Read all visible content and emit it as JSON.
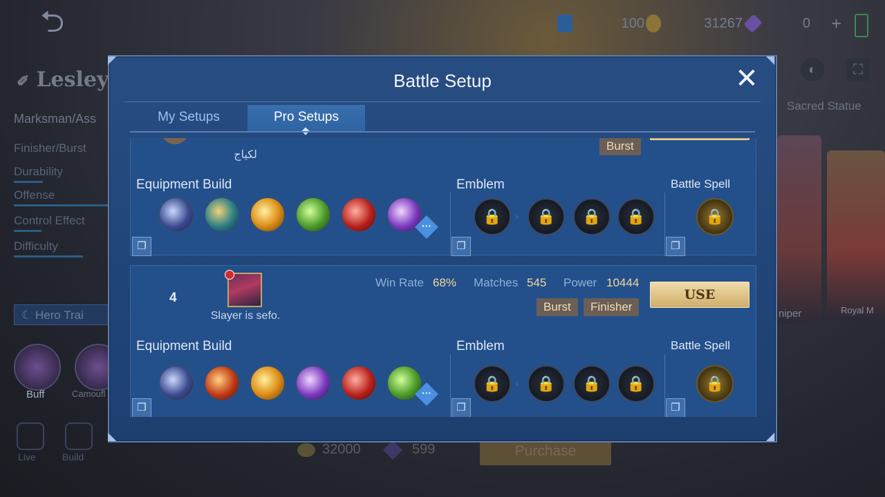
{
  "background": {
    "hero_name": "Lesley",
    "hero_role": "Marksman/Ass",
    "hero_specialty": "Finisher/Burst",
    "hero_stats": [
      "Durability",
      "Offense",
      "Control Effect",
      "Difficulty"
    ],
    "hero_trial_label": "Hero Trai",
    "currency": {
      "tickets": "100",
      "battle_points": "31267",
      "diamonds": "0"
    },
    "sacred_statue_label": "Sacred Statue",
    "skin_labels": [
      "Buff",
      "Camoufl"
    ],
    "right_card_labels": [
      "niper",
      "Royal M"
    ],
    "bottom_labels": [
      "Live",
      "Build"
    ],
    "price_bp": "32000",
    "price_diamonds": "599",
    "purchase_label": "Purchase"
  },
  "modal": {
    "title": "Battle Setup",
    "tabs": [
      "My Setups",
      "Pro Setups"
    ],
    "active_tab": "Pro Setups"
  },
  "entries": [
    {
      "player_name": "لكياج",
      "tags": [
        "Burst"
      ],
      "labels": {
        "equipment": "Equipment Build",
        "emblem": "Emblem",
        "spell": "Battle Spell"
      },
      "items": [
        "crescent-bow-item-icon",
        "boots-item-icon",
        "golden-staff-item-icon",
        "green-blade-item-icon",
        "red-spear-item-icon",
        "purple-wings-item-icon"
      ],
      "emblems": [
        "locked-emblem-icon",
        "locked-talent-icon",
        "locked-talent-icon",
        "locked-talent-icon"
      ],
      "spell": "locked-spell-icon"
    },
    {
      "rank": "4",
      "player_name": "Slayer is sefo.",
      "stats": {
        "win_rate_label": "Win Rate",
        "win_rate": "68%",
        "matches_label": "Matches",
        "matches": "545",
        "power_label": "Power",
        "power": "10444"
      },
      "tags": [
        "Burst",
        "Finisher"
      ],
      "use_label": "USE",
      "labels": {
        "equipment": "Equipment Build",
        "emblem": "Emblem",
        "spell": "Battle Spell"
      },
      "items": [
        "crescent-bow-item-icon",
        "red-boots-item-icon",
        "golden-staff-item-icon",
        "purple-wings-item-icon",
        "red-spear-item-icon",
        "green-blade-item-icon"
      ],
      "emblems": [
        "locked-emblem-icon",
        "locked-talent-icon",
        "locked-talent-icon",
        "locked-talent-icon"
      ],
      "spell": "locked-spell-icon"
    }
  ],
  "colors": {
    "accent_gold": "#f3d69c",
    "panel_blue": "#23508b",
    "use_button": "#e3c58a"
  }
}
